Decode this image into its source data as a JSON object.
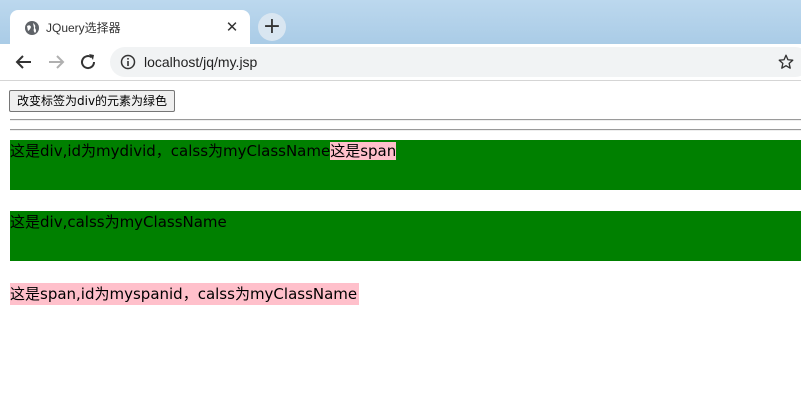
{
  "browser": {
    "tab_title": "JQuery选择器",
    "tab_close": "✕",
    "new_tab": "+",
    "url": "localhost/jq/my.jsp",
    "icons": [
      "globe-icon",
      "back-arrow-icon",
      "forward-arrow-icon",
      "reload-icon",
      "info-icon",
      "star-icon"
    ]
  },
  "page": {
    "button_label": "改变标签为div的元素为绿色",
    "div1_text": "这是div,id为mydivid，calss为myClassName",
    "div1_span_text": "这是span",
    "div2_text": "这是div,calss为myClassName",
    "span_text": "这是span,id为myspanid，calss为myClassName",
    "colors": {
      "div_bg": "#008000",
      "span_bg": "#ffc0cb"
    }
  }
}
